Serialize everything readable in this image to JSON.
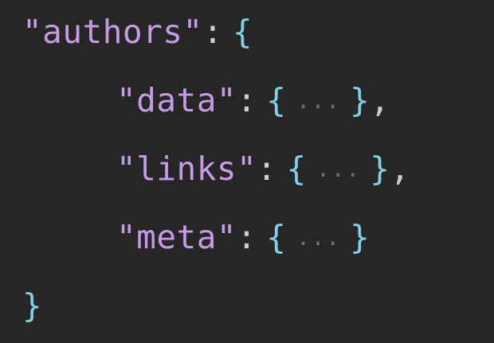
{
  "code": {
    "line1": {
      "key": "\"authors\"",
      "colon": ":",
      "open": "{"
    },
    "line2": {
      "key": "\"data\"",
      "colon": ":",
      "open": "{",
      "fold": "...",
      "close": "}",
      "comma": ","
    },
    "line3": {
      "key": "\"links\"",
      "colon": ":",
      "open": "{",
      "fold": "...",
      "close": "}",
      "comma": ","
    },
    "line4": {
      "key": "\"meta\"",
      "colon": ":",
      "open": "{",
      "fold": "...",
      "close": "}"
    },
    "line5": {
      "close": "}"
    }
  },
  "colors": {
    "background": "#262626",
    "key": "#c79ae6",
    "brace": "#7fd0e6",
    "punctuation": "#cfcfcf",
    "fold": "#6c6c6c"
  }
}
